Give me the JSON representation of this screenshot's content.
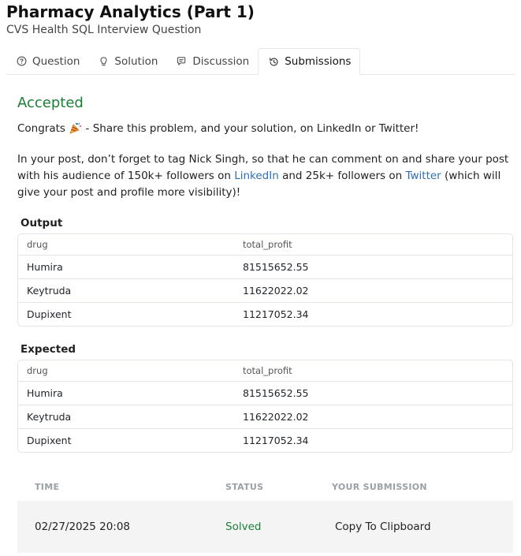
{
  "header": {
    "title": "Pharmacy Analytics (Part 1)",
    "subtitle": "CVS Health SQL Interview Question"
  },
  "tabs": [
    {
      "label": "Question",
      "icon": "question-circle-icon"
    },
    {
      "label": "Solution",
      "icon": "lightbulb-icon"
    },
    {
      "label": "Discussion",
      "icon": "chat-bubble-icon"
    },
    {
      "label": "Submissions",
      "icon": "history-icon",
      "active": true
    }
  ],
  "result": {
    "status": "Accepted",
    "congrats_prefix": "Congrats",
    "congrats_emoji": "party-popper-icon",
    "congrats_suffix": " - Share this problem, and your solution, on LinkedIn or Twitter!",
    "post_text_1": "In your post, don’t forget to tag Nick Singh, so that he can comment on and share your post with his audience of 150k+ followers on ",
    "linkedin_link": "LinkedIn",
    "post_text_2": " and 25k+ followers on ",
    "twitter_link": "Twitter",
    "post_text_3": " (which will give your post and profile more visibility)!"
  },
  "output": {
    "label": "Output",
    "columns": [
      "drug",
      "total_profit"
    ],
    "rows": [
      [
        "Humira",
        "81515652.55"
      ],
      [
        "Keytruda",
        "11622022.02"
      ],
      [
        "Dupixent",
        "11217052.34"
      ]
    ]
  },
  "expected": {
    "label": "Expected",
    "columns": [
      "drug",
      "total_profit"
    ],
    "rows": [
      [
        "Humira",
        "81515652.55"
      ],
      [
        "Keytruda",
        "11622022.02"
      ],
      [
        "Dupixent",
        "11217052.34"
      ]
    ]
  },
  "submissions": {
    "columns": [
      "TIME",
      "STATUS",
      "YOUR SUBMISSION"
    ],
    "rows": [
      {
        "time": "02/27/2025 20:08",
        "status": "Solved",
        "action": "Copy To Clipboard"
      }
    ]
  },
  "colors": {
    "accepted": "#1a7f37",
    "link": "#2f6eb5"
  }
}
